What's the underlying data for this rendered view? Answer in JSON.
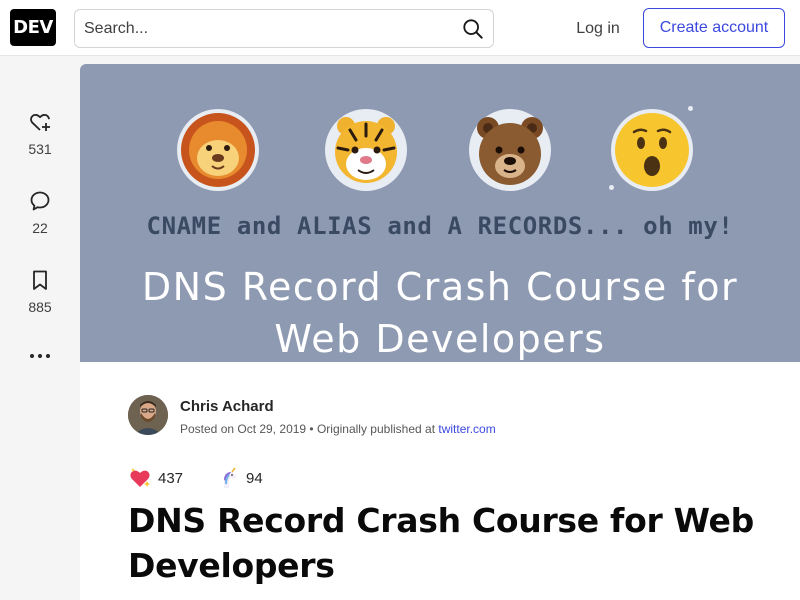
{
  "header": {
    "logo": "DEV",
    "search_placeholder": "Search...",
    "login_label": "Log in",
    "create_account_label": "Create account",
    "accent_color": "#3b49df"
  },
  "sidebar": {
    "items": [
      {
        "icon": "heart-add-icon",
        "count": "531"
      },
      {
        "icon": "comment-icon",
        "count": "22"
      },
      {
        "icon": "bookmark-icon",
        "count": "885"
      }
    ],
    "more_icon": "more-icon"
  },
  "cover": {
    "emojis": [
      "lion-face-icon",
      "tiger-face-icon",
      "bear-face-icon",
      "surprised-face-icon"
    ],
    "subtitle": "CNAME and ALIAS and A RECORDS... oh my!",
    "title_line1": "DNS Record Crash Course for",
    "title_line2": "Web Developers",
    "background_color": "#8e9ab1"
  },
  "author": {
    "name": "Chris Achard",
    "posted": "Posted on Oct 29, 2019 • Originally published at",
    "source_link": "twitter.com"
  },
  "reactions": {
    "hearts": "437",
    "unicorns": "94"
  },
  "article": {
    "title": "DNS Record Crash Course for Web Developers"
  }
}
